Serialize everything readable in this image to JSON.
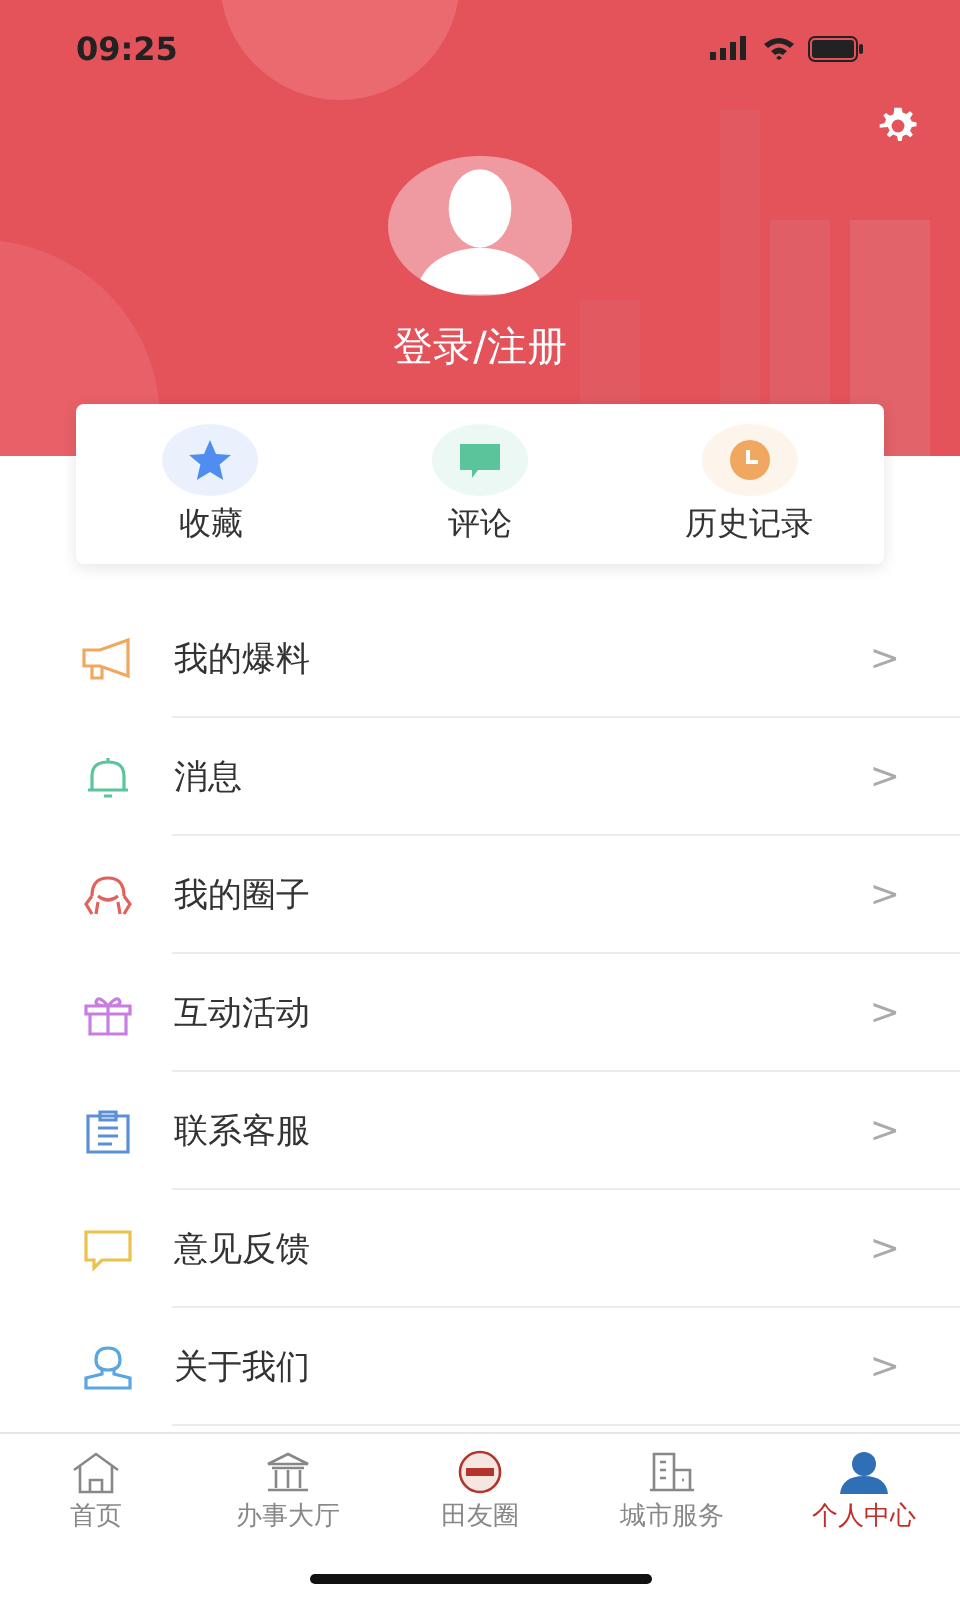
{
  "status_bar": {
    "time": "09:25"
  },
  "profile": {
    "login_label": "登录/注册"
  },
  "shortcuts": [
    {
      "kind": "star",
      "label": "收藏",
      "color": "#4f8ef0"
    },
    {
      "kind": "comment",
      "label": "评论",
      "color": "#5cc49a"
    },
    {
      "kind": "clock",
      "label": "历史记录",
      "color": "#f0a860"
    }
  ],
  "menu": [
    {
      "kind": "megaphone",
      "label": "我的爆料",
      "color": "#f0a860",
      "chevron": ">"
    },
    {
      "kind": "bell",
      "label": "消息",
      "color": "#5cc49a",
      "chevron": ">"
    },
    {
      "kind": "circle",
      "label": "我的圈子",
      "color": "#e0625a",
      "chevron": ">"
    },
    {
      "kind": "gift",
      "label": "互动活动",
      "color": "#c77ee0",
      "chevron": ">"
    },
    {
      "kind": "clipboard",
      "label": "联系客服",
      "color": "#5b8fd6",
      "chevron": ">"
    },
    {
      "kind": "feedback",
      "label": "意见反馈",
      "color": "#e8c24a",
      "chevron": ">"
    },
    {
      "kind": "user",
      "label": "关于我们",
      "color": "#5aa6e0",
      "chevron": ">"
    }
  ],
  "tabs": [
    {
      "kind": "home",
      "label": "首页",
      "selected": false
    },
    {
      "kind": "hall",
      "label": "办事大厅",
      "selected": false
    },
    {
      "kind": "logo",
      "label": "田友圈",
      "selected": false
    },
    {
      "kind": "city",
      "label": "城市服务",
      "selected": false
    },
    {
      "kind": "person",
      "label": "个人中心",
      "selected": true
    }
  ]
}
